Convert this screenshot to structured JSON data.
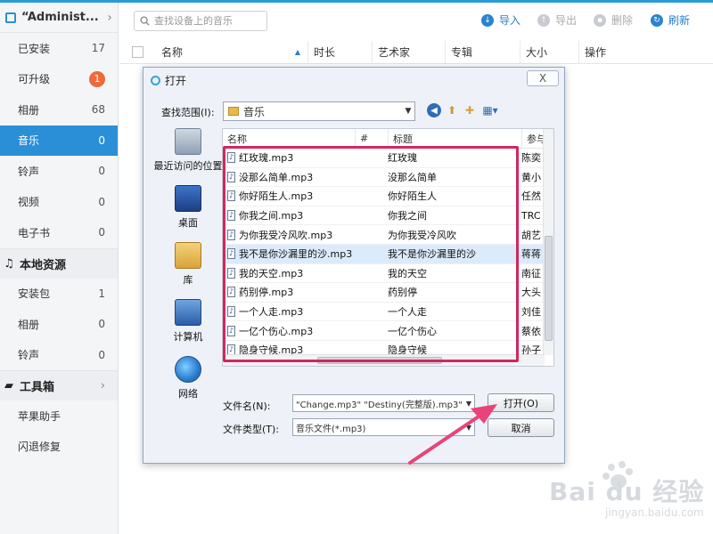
{
  "sidebar": {
    "title": "“Administ...",
    "items": [
      {
        "label": "已安装",
        "count": "17"
      },
      {
        "label": "可升级",
        "badge": "1"
      },
      {
        "label": "相册",
        "count": "68"
      },
      {
        "label": "音乐",
        "count": "0"
      },
      {
        "label": "铃声",
        "count": "0"
      },
      {
        "label": "视频",
        "count": "0"
      },
      {
        "label": "电子书",
        "count": "0"
      }
    ],
    "local_section": "本地资源",
    "local_items": [
      {
        "label": "安装包",
        "count": "1"
      },
      {
        "label": "相册",
        "count": "0"
      },
      {
        "label": "铃声",
        "count": "0"
      }
    ],
    "tools_section": "工具箱",
    "tools_items": [
      {
        "label": "苹果助手"
      },
      {
        "label": "闪退修复"
      }
    ]
  },
  "toolbar": {
    "search_placeholder": "查找设备上的音乐",
    "import": "导入",
    "export": "导出",
    "delete": "删除",
    "refresh": "刷新"
  },
  "table_headers": [
    "名称",
    "时长",
    "艺术家",
    "专辑",
    "大小",
    "操作"
  ],
  "dialog": {
    "title": "打开",
    "close": "X",
    "lookin_label": "查找范围(I):",
    "lookin_value": "音乐",
    "places": [
      "最近访问的位置",
      "桌面",
      "库",
      "计算机",
      "网络"
    ],
    "columns": [
      "名称",
      "#",
      "标题",
      "参与"
    ],
    "files": [
      {
        "name": "红玫瑰.mp3",
        "title": "红玫瑰",
        "artist": "陈奕"
      },
      {
        "name": "没那么简单.mp3",
        "title": "没那么简单",
        "artist": "黄小"
      },
      {
        "name": "你好陌生人.mp3",
        "title": "你好陌生人",
        "artist": "任然"
      },
      {
        "name": "你我之间.mp3",
        "title": "你我之间",
        "artist": "TRC"
      },
      {
        "name": "为你我受冷风吹.mp3",
        "title": "为你我受冷风吹",
        "artist": "胡艺"
      },
      {
        "name": "我不是你沙漏里的沙.mp3",
        "title": "我不是你沙漏里的沙",
        "artist": "蒋蒋"
      },
      {
        "name": "我的天空.mp3",
        "title": "我的天空",
        "artist": "南征"
      },
      {
        "name": "药别停.mp3",
        "title": "药别停",
        "artist": "大头"
      },
      {
        "name": "一个人走.mp3",
        "title": "一个人走",
        "artist": "刘佳"
      },
      {
        "name": "一亿个伤心.mp3",
        "title": "一亿个伤心",
        "artist": "蔡依"
      },
      {
        "name": "隐身守候.mp3",
        "title": "隐身守候",
        "artist": "孙子"
      }
    ],
    "filename_label": "文件名(N):",
    "filename_value": "\"Change.mp3\" \"Destiny(完整版).mp3\" \"G",
    "filetype_label": "文件类型(T):",
    "filetype_value": "音乐文件(*.mp3)",
    "open_button": "打开(O)",
    "cancel_button": "取消"
  },
  "watermark": {
    "brand": "Bai du 经验",
    "url": "jingyan.baidu.com"
  },
  "colors": {
    "accent": "#2a8fd6",
    "highlight": "#d4265d",
    "badge": "#ef6a3a"
  }
}
